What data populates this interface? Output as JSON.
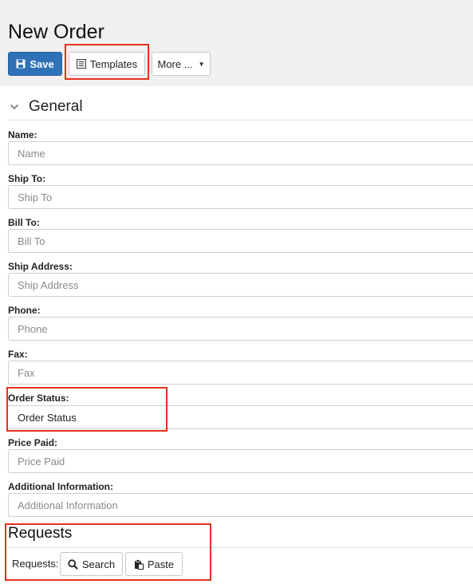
{
  "header": {
    "title": "New Order",
    "buttons": {
      "save_label": "Save",
      "templates_label": "Templates",
      "more_label": "More ..."
    }
  },
  "general": {
    "title": "General",
    "fields": {
      "name": {
        "label": "Name:",
        "placeholder": "Name"
      },
      "ship_to": {
        "label": "Ship To:",
        "placeholder": "Ship To"
      },
      "bill_to": {
        "label": "Bill To:",
        "placeholder": "Bill To"
      },
      "ship_address": {
        "label": "Ship Address:",
        "placeholder": "Ship Address"
      },
      "phone": {
        "label": "Phone:",
        "placeholder": "Phone"
      },
      "fax": {
        "label": "Fax:",
        "placeholder": "Fax"
      },
      "order_status": {
        "label": "Order Status:",
        "value": "Order Status"
      },
      "price_paid": {
        "label": "Price Paid:",
        "placeholder": "Price Paid"
      },
      "additional_information": {
        "label": "Additional Information:",
        "placeholder": "Additional Information"
      }
    }
  },
  "requests": {
    "title": "Requests",
    "label": "Requests:",
    "search_label": "Search",
    "paste_label": "Paste"
  },
  "colors": {
    "primary": "#2f72b8",
    "highlight": "#e8301e",
    "toolbar_bg": "#f0f0f0"
  },
  "icons": {
    "save": "floppy-disk-icon",
    "templates": "list-icon",
    "more": "caret-down-icon",
    "section_toggle": "chevron-down-icon",
    "search": "magnifier-icon",
    "paste": "clipboard-icon"
  }
}
